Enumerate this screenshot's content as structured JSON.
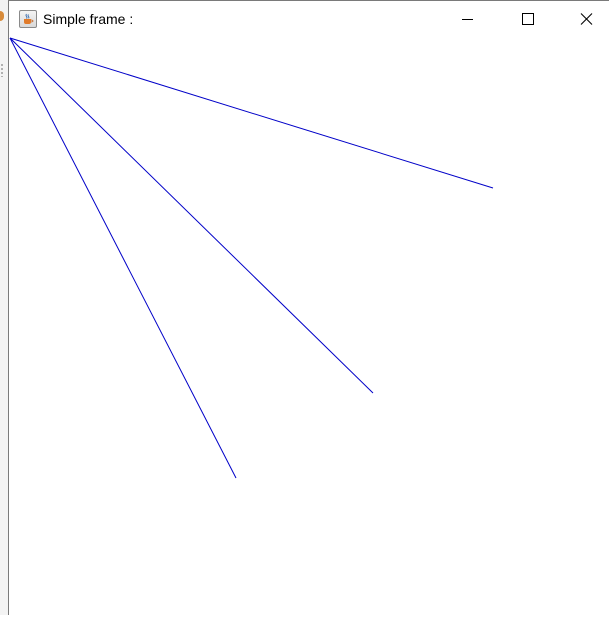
{
  "window": {
    "title": "Simple frame :",
    "icon": "java-cup-icon"
  },
  "titlebar_buttons": {
    "minimize_icon": "minimize-icon",
    "maximize_icon": "maximize-icon",
    "close_icon": "close-icon"
  },
  "drawing": {
    "line_color": "#0000c8",
    "background_color": "#ffffff",
    "lines": 3
  }
}
